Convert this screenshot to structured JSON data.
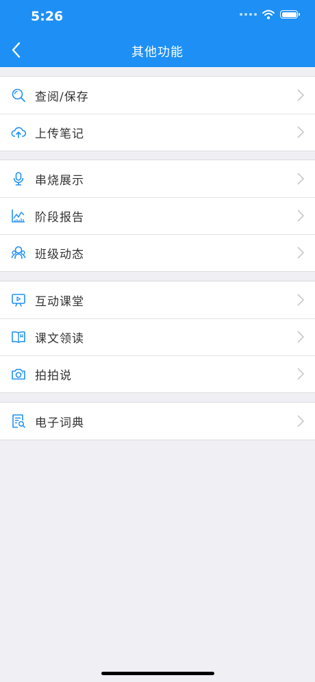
{
  "status": {
    "time": "5:26"
  },
  "nav": {
    "title": "其他功能",
    "back_icon": "chevron-left-icon"
  },
  "accent_color": "#1e90f5",
  "groups": [
    {
      "items": [
        {
          "label": "查阅/保存",
          "icon": "search-icon"
        },
        {
          "label": "上传笔记",
          "icon": "cloud-upload-icon"
        }
      ]
    },
    {
      "items": [
        {
          "label": "串烧展示",
          "icon": "microphone-icon"
        },
        {
          "label": "阶段报告",
          "icon": "line-chart-icon"
        },
        {
          "label": "班级动态",
          "icon": "class-people-icon"
        }
      ]
    },
    {
      "items": [
        {
          "label": "互动课堂",
          "icon": "screen-play-icon"
        },
        {
          "label": "课文领读",
          "icon": "open-book-icon"
        },
        {
          "label": "拍拍说",
          "icon": "camera-icon"
        }
      ]
    },
    {
      "items": [
        {
          "label": "电子词典",
          "icon": "dictionary-icon"
        }
      ]
    }
  ]
}
